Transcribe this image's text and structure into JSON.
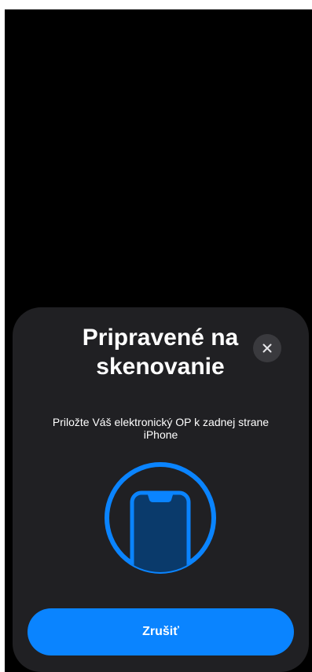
{
  "sheet": {
    "title": "Pripravené na skenovanie",
    "subtitle": "Priložte Váš elektronický OP k zadnej strane iPhone",
    "close_icon": "close-icon",
    "illustration_icon": "phone-scan-icon",
    "cancel_label": "Zrušiť"
  },
  "colors": {
    "screen_background": "#000000",
    "sheet_background": "#202023",
    "accent": "#0a84ff",
    "illustration_fill": "#0a3a6b",
    "close_button_background": "#3a3a3e"
  }
}
